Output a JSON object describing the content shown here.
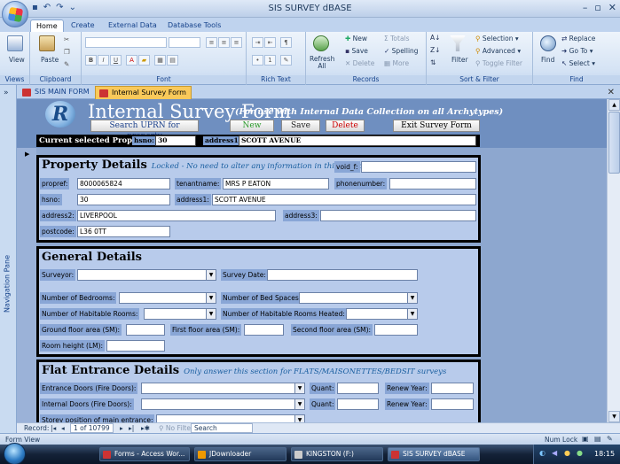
{
  "window": {
    "title": "SIS SURVEY dBASE"
  },
  "ribbon_tabs": [
    "Home",
    "Create",
    "External Data",
    "Database Tools"
  ],
  "ribbon": {
    "views": {
      "view_label": "View",
      "group": "Views"
    },
    "clipboard": {
      "paste_label": "Paste",
      "group": "Clipboard"
    },
    "font": {
      "group": "Font",
      "bold": "B",
      "italic": "I",
      "underline": "U"
    },
    "richtext": {
      "group": "Rich Text"
    },
    "records": {
      "group": "Records",
      "refresh": "Refresh All",
      "new": "New",
      "save": "Save",
      "delete": "Delete",
      "totals": "Totals",
      "spelling": "Spelling",
      "more": "More"
    },
    "sortfilter": {
      "group": "Sort & Filter",
      "filter": "Filter",
      "selection": "Selection",
      "advanced": "Advanced",
      "toggle": "Toggle Filter"
    },
    "find": {
      "group": "Find",
      "find": "Find",
      "replace": "Replace",
      "goto": "Go To",
      "select": "Select"
    }
  },
  "doc_tabs": [
    "SIS MAIN FORM",
    "Internal Survey Form"
  ],
  "nav_pane_label": "Navigation Pane",
  "form": {
    "title": "Internal Survey Form",
    "subtitle": "(For use with Internal Data Collection on all Archytypes)",
    "logo_letter": "R",
    "buttons": {
      "search": "Search UPRN for property",
      "new": "New",
      "save": "Save",
      "delete": "Delete",
      "exit": "Exit Survey Form"
    },
    "current_property": {
      "label": "Current selected Property:",
      "hsno_label": "hsno:",
      "hsno_value": "30",
      "address1_label": "address1:",
      "address1_value": "SCOTT AVENUE"
    }
  },
  "property_details": {
    "title": "Property Details",
    "note": "Locked - No need to alter any information in this section.",
    "void_label": "void_f:",
    "propref_label": "propref:",
    "propref_value": "8000065824",
    "tenantname_label": "tenantname:",
    "tenantname_value": "MRS P EATON",
    "phonenumber_label": "phonenumber:",
    "phonenumber_value": "",
    "hsno_label": "hsno:",
    "hsno_value": "30",
    "address1_label": "address1:",
    "address1_value": "SCOTT AVENUE",
    "address2_label": "address2:",
    "address2_value": "LIVERPOOL",
    "address3_label": "address3:",
    "address3_value": "",
    "postcode_label": "postcode:",
    "postcode_value": "L36 0TT"
  },
  "general_details": {
    "title": "General Details",
    "surveyor": "Surveyor:",
    "survey_date": "Survey Date:",
    "bedrooms": "Number of Bedrooms:",
    "bed_spaces": "Number of Bed Spaces:",
    "habitable": "Number of Habitable Rooms:",
    "habitable_heated": "Number of Habitable Rooms Heated:",
    "ground_area": "Ground floor area (SM):",
    "first_area": "First floor area (SM):",
    "second_area": "Second floor area (SM):",
    "room_height": "Room height (LM):"
  },
  "flat_entrance": {
    "title": "Flat Entrance Details",
    "note": "Only answer this section for FLATS/MAISONETTES/BEDSIT surveys",
    "entrance_doors": "Entrance Doors (Fire Doors):",
    "internal_doors": "Internal Doors (Fire Doors):",
    "quant": "Quant:",
    "renew_year": "Renew Year:",
    "storey": "Storey position of main entrance:"
  },
  "record_nav": {
    "label": "Record:",
    "current": "1 of 10799",
    "filter": "No Filter",
    "search": "Search"
  },
  "status": {
    "left": "Form View",
    "right": "Num Lock"
  },
  "taskbar": {
    "items": [
      "Forms - Access Wor...",
      "JDownloader",
      "KINGSTON (F:)",
      "SIS SURVEY dBASE"
    ],
    "clock": "18:15"
  },
  "colors": {
    "accent": "#6f8fc0",
    "section_bg": "#b8cbeb",
    "active_tab": "#f9c95a"
  }
}
